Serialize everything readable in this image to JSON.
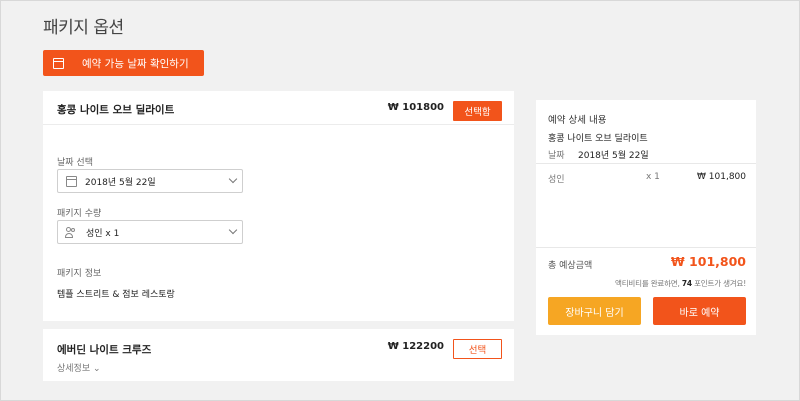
{
  "page": {
    "title": "패키지 옵션"
  },
  "actions": {
    "check_dates_label": "예약 가능 날짜 확인하기"
  },
  "packages": [
    {
      "name": "홍콩 나이트 오브 딜라이트",
      "price": "₩ 101800",
      "select_label": "선택함",
      "date_label": "날짜 선택",
      "date_value": "2018년 5월 22일",
      "qty_label": "패키지 수량",
      "qty_value": "성인 x 1",
      "info_label": "패키지 정보",
      "info_value": "템플 스트리트 & 점보 레스토랑"
    },
    {
      "name": "에버딘 나이트 크루즈",
      "price": "₩ 122200",
      "select_label": "선택",
      "details_label": "상세정보 ⌄"
    }
  ],
  "summary": {
    "title": "예약 상세 내용",
    "package_name": "홍콩 나이트 오브 딜라이트",
    "date_label": "날짜",
    "date_value": "2018년 5월 22일",
    "row_label": "성인",
    "row_qty": "x 1",
    "row_price": "₩ 101,800",
    "total_label": "총 예상금액",
    "total_value": "₩ 101,800",
    "points_prefix": "액티비티를 완료하면, ",
    "points_value": "74",
    "points_suffix": " 포인트가 생겨요!",
    "cart_label": "장바구니 담기",
    "book_label": "바로 예약"
  },
  "colors": {
    "accent": "#f2541b",
    "cart": "#f6a623"
  }
}
